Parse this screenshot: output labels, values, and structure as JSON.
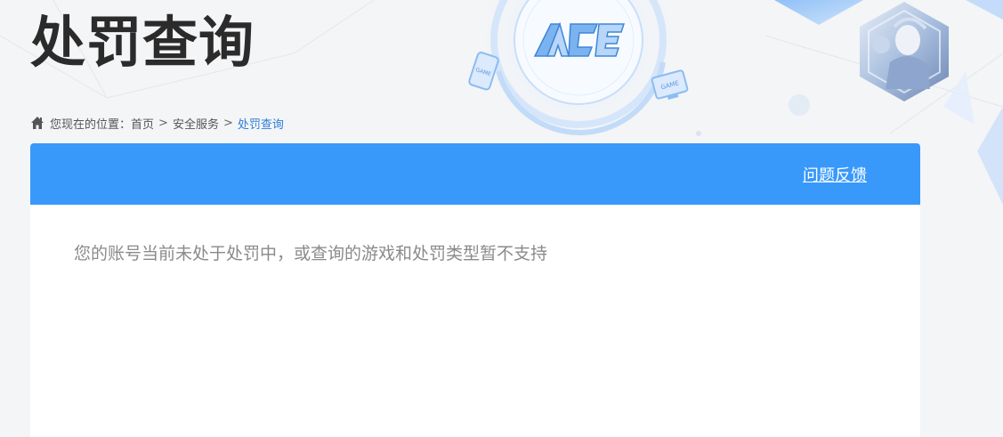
{
  "page": {
    "title": "处罚查询"
  },
  "logo": {
    "text": "ACE",
    "icon": "ace-logo"
  },
  "decorations": {
    "phone_label": "GAME",
    "monitor_label": "GAME",
    "avatar_icon": "game-character-avatar"
  },
  "breadcrumb": {
    "icon": "home-icon",
    "prefix": "您现在的位置：",
    "items": [
      {
        "label": "首页"
      },
      {
        "label": "安全服务"
      },
      {
        "label": "处罚查询"
      }
    ],
    "separator": ">"
  },
  "panel": {
    "feedback_label": "问题反馈",
    "message": "您的账号当前未处于处罚中，或查询的游戏和处罚类型暂不支持"
  },
  "colors": {
    "header_blue": "#3899fb",
    "breadcrumb_current": "#2f7fd6",
    "title": "#2b2b2b"
  }
}
